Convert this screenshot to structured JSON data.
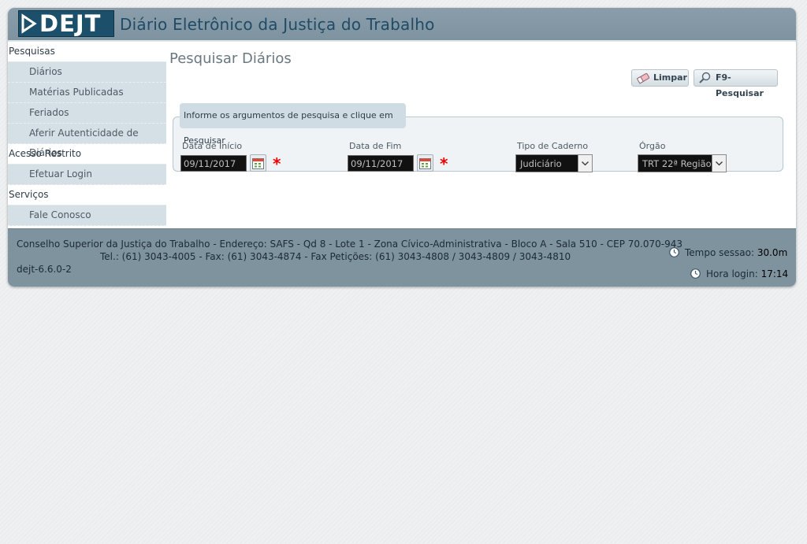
{
  "header": {
    "logo_text": "DEJT",
    "title": "Diário Eletrônico da Justiça do Trabalho"
  },
  "sidebar": {
    "sections": [
      {
        "label": "Pesquisas",
        "items": [
          "Diários",
          "Matérias Publicadas",
          "Feriados",
          "Aferir Autenticidade de Diários"
        ]
      },
      {
        "label": "Acesso Restrito",
        "items": [
          "Efetuar Login"
        ]
      },
      {
        "label": "Serviços",
        "items": [
          "Fale Conosco"
        ]
      }
    ]
  },
  "main": {
    "title": "Pesquisar Diários",
    "buttons": {
      "limpar": "Limpar",
      "pesquisar": "F9-Pesquisar"
    },
    "legend": "Informe os argumentos de pesquisa e clique em Pesquisar",
    "fields": {
      "data_inicio": {
        "label": "Data de Início",
        "value": "09/11/2017"
      },
      "data_fim": {
        "label": "Data de Fim",
        "value": "09/11/2017"
      },
      "tipo_caderno": {
        "label": "Tipo de Caderno",
        "value": "Judiciário"
      },
      "orgao": {
        "label": "Órgão",
        "value": "TRT 22ª Região"
      }
    },
    "required_mark": "*"
  },
  "footer": {
    "line1": "Conselho Superior da Justiça do Trabalho - Endereço: SAFS - Qd 8 - Lote 1 - Zona Cívico-Administrativa - Bloco A - Sala 510 - CEP 70.070-943",
    "line2": "Tel.: (61) 3043-4005 - Fax: (61) 3043-4874 - Fax Petições: (61) 3043-4808 / 3043-4809 / 3043-4810",
    "version": "dejt-6.6.0-2",
    "session_label": "Tempo sessao:",
    "session_value": "30.0m",
    "login_label": "Hora login:",
    "login_value": "17:14"
  },
  "icons": [
    "dejt-arrow-icon",
    "eraser-icon",
    "magnifier-icon",
    "calendar-icon",
    "chevron-down-icon",
    "clock-icon"
  ]
}
